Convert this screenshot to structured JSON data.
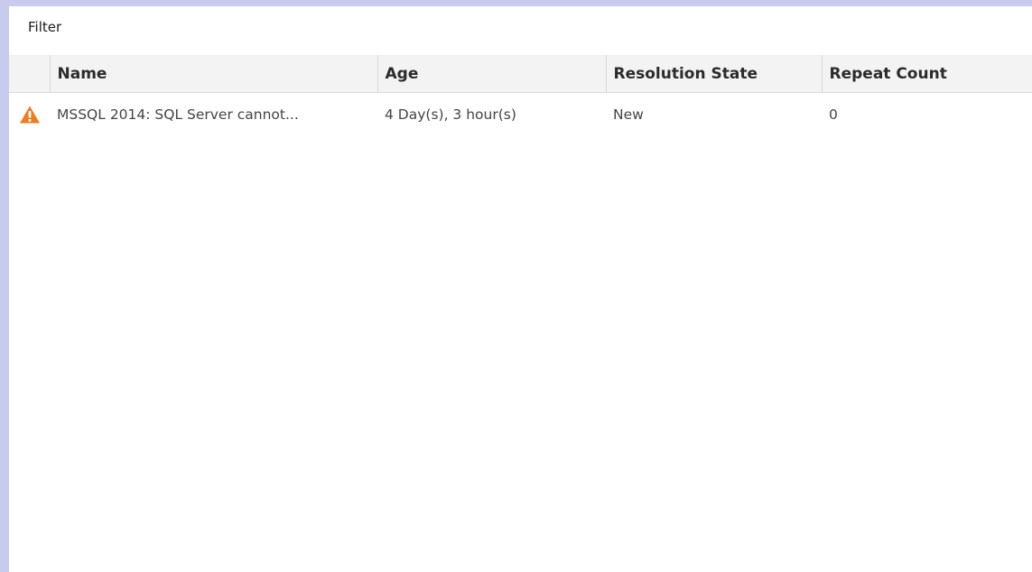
{
  "toolbar": {
    "filter_label": "Filter"
  },
  "grid": {
    "columns": [
      {
        "label": "Name"
      },
      {
        "label": "Age"
      },
      {
        "label": "Resolution State"
      },
      {
        "label": "Repeat Count"
      }
    ],
    "rows": [
      {
        "severity_icon": "warning-icon",
        "severity_color": "#f07c1e",
        "name": "MSSQL 2014: SQL Server cannot...",
        "age": "4 Day(s), 3 hour(s)",
        "resolution_state": "New",
        "repeat_count": "0"
      }
    ]
  },
  "colors": {
    "frame_background": "#c9cbee",
    "header_background": "#f3f3f3",
    "warning": "#f07c1e"
  }
}
